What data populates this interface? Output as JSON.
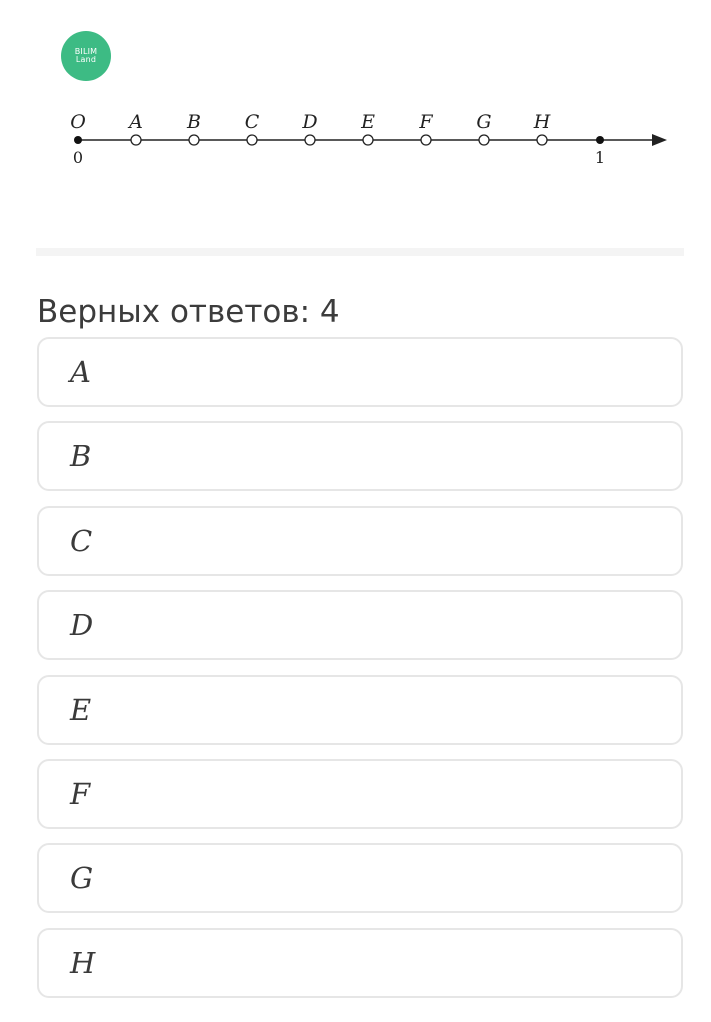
{
  "logo": {
    "line1": "BILIM",
    "line2": "Land"
  },
  "number_line": {
    "start_label": "O",
    "start_value": "0",
    "end_value": "1",
    "points": [
      "A",
      "B",
      "C",
      "D",
      "E",
      "F",
      "G",
      "H"
    ]
  },
  "answers_count_text": "Верных ответов: 4",
  "options": [
    {
      "label": "A"
    },
    {
      "label": "B"
    },
    {
      "label": "C"
    },
    {
      "label": "D"
    },
    {
      "label": "E"
    },
    {
      "label": "F"
    },
    {
      "label": "G"
    },
    {
      "label": "H"
    }
  ],
  "colors": {
    "logo_green": "#3dbb84",
    "border": "#e6e6e6",
    "text": "#3c3c3c"
  }
}
